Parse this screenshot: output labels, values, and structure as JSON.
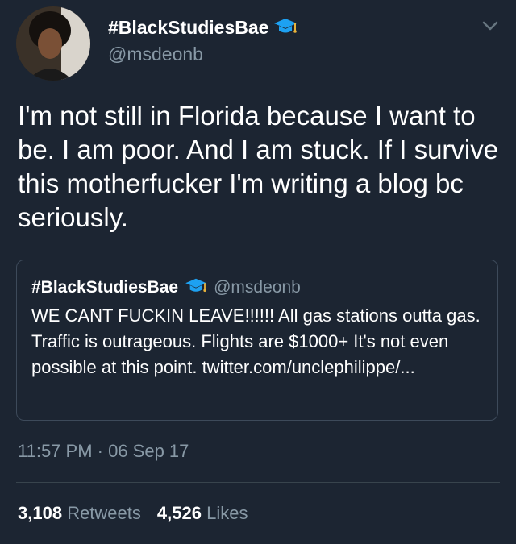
{
  "author": {
    "display_name": "#BlackStudiesBae",
    "handle": "@msdeonb",
    "badge_icon": "graduation-cap-icon"
  },
  "tweet": {
    "text": "I'm not still in Florida because I want to be. I am poor. And I am stuck. If I survive this motherfucker I'm writing a blog bc seriously."
  },
  "quoted_tweet": {
    "display_name": "#BlackStudiesBae",
    "handle": "@msdeonb",
    "text": "WE CANT FUCKIN LEAVE!!!!!! All gas stations outta gas. Traffic is outrageous. Flights are $1000+ It's not even possible at this point. twitter.com/unclephilippe/..."
  },
  "meta": {
    "timestamp": "11:57 PM · 06 Sep 17"
  },
  "stats": {
    "retweets_count": "3,108",
    "retweets_label": "Retweets",
    "likes_count": "4,526",
    "likes_label": "Likes"
  },
  "colors": {
    "background": "#1c2532",
    "secondary_text": "#8899a6",
    "badge_blue": "#1da1f2"
  }
}
